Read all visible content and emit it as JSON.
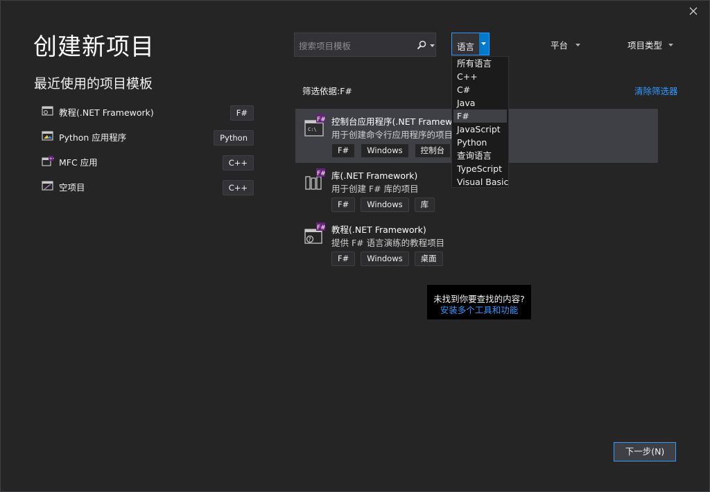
{
  "page": {
    "title": "创建新项目",
    "recent_heading": "最近使用的项目模板"
  },
  "recent": [
    {
      "label": "教程(.NET Framework)",
      "tag": "F#",
      "icon": "tutorial-template-icon"
    },
    {
      "label": "Python 应用程序",
      "tag": "Python",
      "icon": "python-app-icon"
    },
    {
      "label": "MFC 应用",
      "tag": "C++",
      "icon": "mfc-app-icon"
    },
    {
      "label": "空项目",
      "tag": "C++",
      "icon": "empty-project-icon"
    }
  ],
  "search": {
    "placeholder": "搜索项目模板",
    "value": ""
  },
  "filters": {
    "language_label": "语言",
    "platform_label": "平台",
    "project_type_label": "项目类型",
    "filtered_by": "筛选依据:F#",
    "clear_label": "清除筛选器"
  },
  "language_menu": {
    "options": [
      "所有语言",
      "C++",
      "C#",
      "Java",
      "F#",
      "JavaScript",
      "Python",
      "查询语言",
      "TypeScript",
      "Visual Basic"
    ],
    "highlighted": "F#"
  },
  "templates": [
    {
      "title": "控制台应用程序(.NET Framework)",
      "description": "用于创建命令行应用程序的项目",
      "tags": [
        "F#",
        "Windows",
        "控制台"
      ],
      "icon": "console-app-icon",
      "selected": true
    },
    {
      "title": "库(.NET Framework)",
      "description": "用于创建 F# 库的项目",
      "tags": [
        "F#",
        "Windows",
        "库"
      ],
      "icon": "library-icon",
      "selected": false
    },
    {
      "title": "教程(.NET Framework)",
      "description": "提供 F# 语言演练的教程项目",
      "tags": [
        "F#",
        "Windows",
        "桌面"
      ],
      "icon": "tutorial-icon",
      "selected": false
    }
  ],
  "not_found": {
    "question": "未找到你要查找的内容?",
    "link": "安装多个工具和功能"
  },
  "next_button": "下一步(N)",
  "colors": {
    "background": "#252526",
    "accent": "#007acc",
    "link": "#3399ff",
    "selected_row": "#3f3f46"
  }
}
